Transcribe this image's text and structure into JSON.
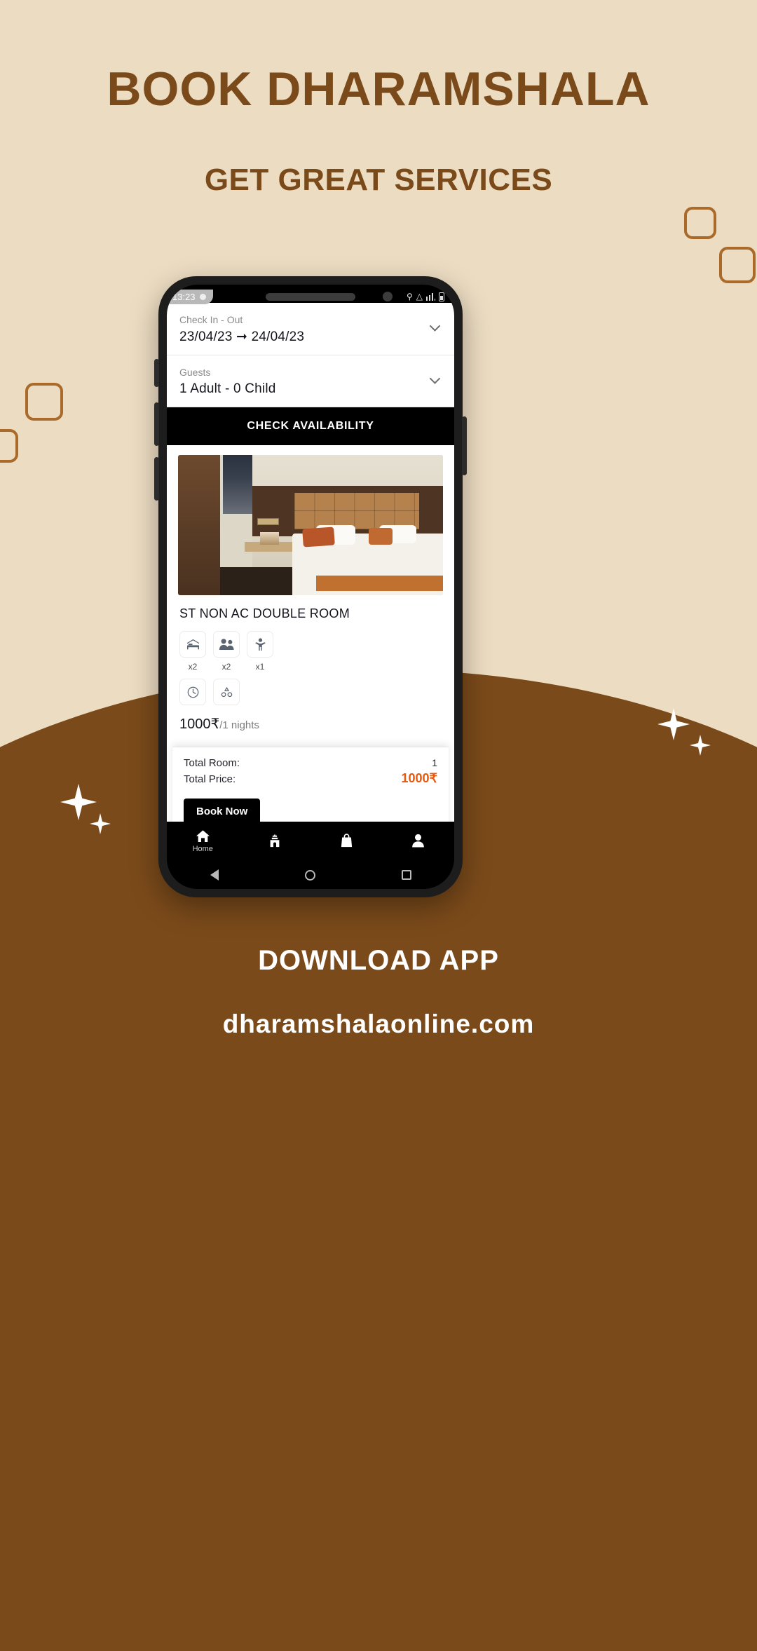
{
  "poster": {
    "headline": "BOOK DHARAMSHALA",
    "subhead": "GET GREAT SERVICES",
    "download_label": "DOWNLOAD APP",
    "website": "dharamshalaonline.com",
    "colors": {
      "background": "#ecdcc2",
      "brand_brown": "#7a4a1a",
      "outline_brown": "#a96a2a",
      "accent_orange": "#e8590c",
      "white": "#ffffff"
    }
  },
  "phone": {
    "status_bar": {
      "time": "13:23",
      "left_icons": [
        "dot-icon",
        "circle-icon"
      ],
      "right_icons": [
        "search-icon",
        "wifi-icon",
        "signal-icon",
        "battery-icon"
      ]
    },
    "app": {
      "check_in_out": {
        "label": "Check In - Out",
        "value": "23/04/23 ➞ 24/04/23"
      },
      "guests": {
        "label": "Guests",
        "value": "1 Adult - 0 Child"
      },
      "check_availability_label": "CHECK AVAILABILITY",
      "room": {
        "title": "ST NON AC DOUBLE ROOM",
        "amenities": [
          {
            "icon": "bed-icon",
            "count": "x2"
          },
          {
            "icon": "adults-icon",
            "count": "x2"
          },
          {
            "icon": "child-icon",
            "count": "x1"
          }
        ],
        "extra_amenities": [
          {
            "icon": "clock-icon"
          },
          {
            "icon": "recycle-icon"
          }
        ],
        "price": "1000₹",
        "price_per": "/1 nights"
      },
      "summary": {
        "total_room_label": "Total Room:",
        "total_room_value": "1",
        "total_price_label": "Total Price:",
        "total_price_value": "1000₹",
        "book_now_label": "Book Now"
      },
      "bottom_nav": [
        {
          "icon": "home-icon",
          "label": "Home"
        },
        {
          "icon": "temple-icon",
          "label": ""
        },
        {
          "icon": "bag-icon",
          "label": ""
        },
        {
          "icon": "person-icon",
          "label": ""
        }
      ]
    }
  }
}
